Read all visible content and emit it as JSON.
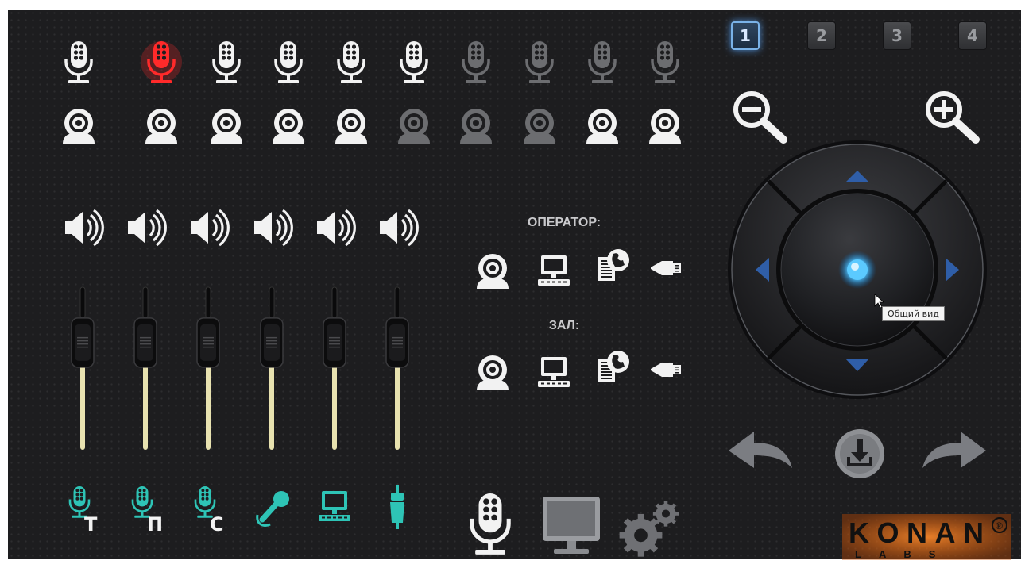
{
  "mic_row": [
    {
      "icon": "microphone-icon",
      "state": "on"
    },
    {
      "icon": "microphone-icon",
      "state": "active-red"
    },
    {
      "icon": "microphone-icon",
      "state": "on"
    },
    {
      "icon": "microphone-icon",
      "state": "on"
    },
    {
      "icon": "microphone-icon",
      "state": "on"
    },
    {
      "icon": "microphone-icon",
      "state": "on"
    },
    {
      "icon": "microphone-icon",
      "state": "off"
    },
    {
      "icon": "microphone-icon",
      "state": "off"
    },
    {
      "icon": "microphone-icon",
      "state": "off"
    },
    {
      "icon": "microphone-icon",
      "state": "off"
    }
  ],
  "cam_row": [
    {
      "icon": "webcam-icon",
      "state": "on"
    },
    {
      "icon": "webcam-icon",
      "state": "on"
    },
    {
      "icon": "webcam-icon",
      "state": "on"
    },
    {
      "icon": "webcam-icon",
      "state": "on"
    },
    {
      "icon": "webcam-icon",
      "state": "on"
    },
    {
      "icon": "webcam-icon",
      "state": "off"
    },
    {
      "icon": "webcam-icon",
      "state": "off"
    },
    {
      "icon": "webcam-icon",
      "state": "off"
    },
    {
      "icon": "webcam-icon",
      "state": "on"
    },
    {
      "icon": "webcam-icon",
      "state": "on"
    }
  ],
  "speakers": [
    "speaker-icon",
    "speaker-icon",
    "speaker-icon",
    "speaker-icon",
    "speaker-icon",
    "speaker-icon"
  ],
  "faders": [
    {
      "level": 0.42
    },
    {
      "level": 0.42
    },
    {
      "level": 0.42
    },
    {
      "level": 0.42
    },
    {
      "level": 0.42
    },
    {
      "level": 0.42
    }
  ],
  "channel_labels": [
    "Т",
    "П",
    "С"
  ],
  "channel_icons": [
    "mic-t-icon",
    "mic-p-icon",
    "mic-s-icon",
    "handheld-mic-icon",
    "computer-icon",
    "audio-jack-icon"
  ],
  "colors": {
    "accent_teal": "#2ec4b6",
    "active_red": "#ff2a2a",
    "joystick_glow": "#4fc3ff",
    "tab_active_border": "#7ab2e8",
    "logo_orange": "#e8701a"
  },
  "operator": {
    "title": "ОПЕРАТОР:",
    "icons": [
      "webcam-icon",
      "computer-icon",
      "document-globe-icon",
      "network-plug-icon"
    ]
  },
  "hall": {
    "title": "ЗАЛ:",
    "icons": [
      "webcam-icon",
      "computer-icon",
      "document-globe-icon",
      "network-plug-icon"
    ]
  },
  "tabs": [
    "1",
    "2",
    "3",
    "4"
  ],
  "active_tab": "1",
  "zoom": {
    "out_icon": "zoom-out-icon",
    "in_icon": "zoom-in-icon"
  },
  "joystick": {
    "tooltip": "Общий вид"
  },
  "nav_actions": [
    "undo-arrow-icon",
    "download-icon",
    "redo-arrow-icon"
  ],
  "bottom_icons": [
    "microphone-icon",
    "monitor-icon",
    "settings-gears-icon"
  ],
  "logo": {
    "main": "KONAN",
    "sub": "LABS",
    "mark": "®"
  }
}
